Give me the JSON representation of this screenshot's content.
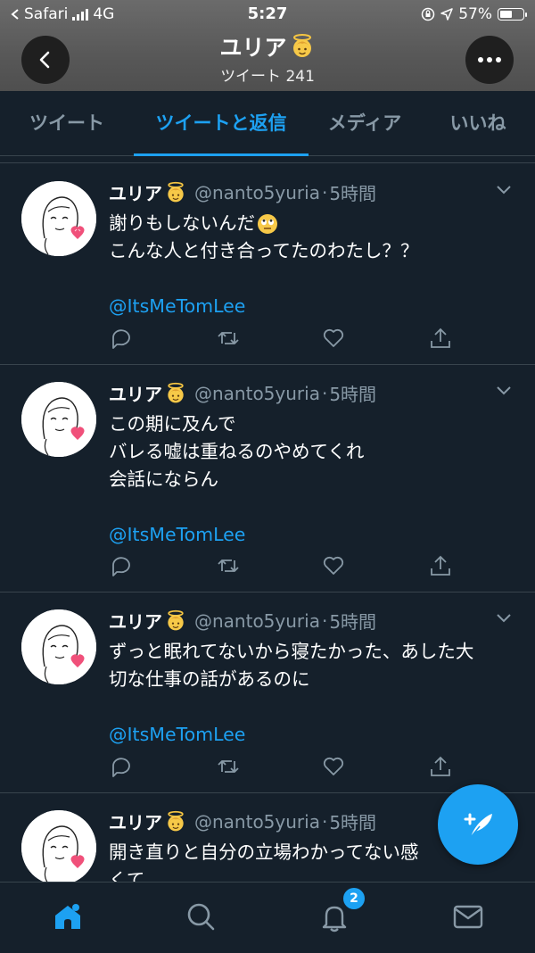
{
  "status_bar": {
    "carrier": "Safari",
    "network": "4G",
    "time": "5:27",
    "battery": "57%",
    "battery_level": 0.57
  },
  "header": {
    "title": "ユリア",
    "subtitle": "ツイート 241"
  },
  "tabs": [
    {
      "label": "ツイート",
      "active": false
    },
    {
      "label": "ツイートと返信",
      "active": true
    },
    {
      "label": "メディア",
      "active": false
    },
    {
      "label": "いいね",
      "active": false
    }
  ],
  "tweets": [
    {
      "name": "ユリア",
      "handle": "@nanto5yuria",
      "time": "5時間",
      "lines": [
        "謝りもしないんだ",
        "こんな人と付き合ってたのわたし？？"
      ],
      "mention": "@ItsMeTomLee"
    },
    {
      "name": "ユリア",
      "handle": "@nanto5yuria",
      "time": "5時間",
      "lines": [
        "この期に及んで",
        "バレる嘘は重ねるのやめてくれ",
        "会話にならん"
      ],
      "mention": "@ItsMeTomLee"
    },
    {
      "name": "ユリア",
      "handle": "@nanto5yuria",
      "time": "5時間",
      "lines": [
        "ずっと眠れてないから寝たかった、あした大",
        "切な仕事の話があるのに"
      ],
      "mention": "@ItsMeTomLee"
    },
    {
      "name": "ユリア",
      "handle": "@nanto5yuria",
      "time": "5時間",
      "lines": [
        "開き直りと自分の立場わかってない感",
        "くて"
      ],
      "mention": ""
    }
  ],
  "bottom_nav": {
    "notification_count": "2"
  },
  "colors": {
    "background": "#15202b",
    "accent": "#1da1f2",
    "secondary_text": "#8899a6",
    "divider": "#38444d"
  }
}
